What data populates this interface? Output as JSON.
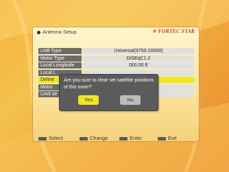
{
  "header": {
    "title": "Antenna Setup",
    "brand": "FORTEC STAR"
  },
  "settings": {
    "rows": [
      {
        "label": "LNB Type",
        "value": "Universal(9750-10600)"
      },
      {
        "label": "Motor Type",
        "value": "DiSEqC1.2"
      },
      {
        "label": "Local Longitude",
        "value": "000.00 E"
      },
      {
        "label": "Local L",
        "value": ""
      },
      {
        "label": "Delete",
        "value": ""
      },
      {
        "label": "Motor",
        "value": ""
      },
      {
        "label": "Limit se",
        "value": ""
      }
    ],
    "highlighted_index": 4
  },
  "dialog": {
    "message": "Are you sure to clear set satellite positions of this tuner?",
    "yes_label": "Yes",
    "no_label": "No"
  },
  "footer": {
    "select": "Select",
    "change": "Change",
    "enter": "Enter",
    "exit": "Exit"
  },
  "colors": {
    "highlight": "#f0e52a",
    "dialog_bg": "#5b5b5b",
    "label_bg": "#6c6c6c"
  }
}
